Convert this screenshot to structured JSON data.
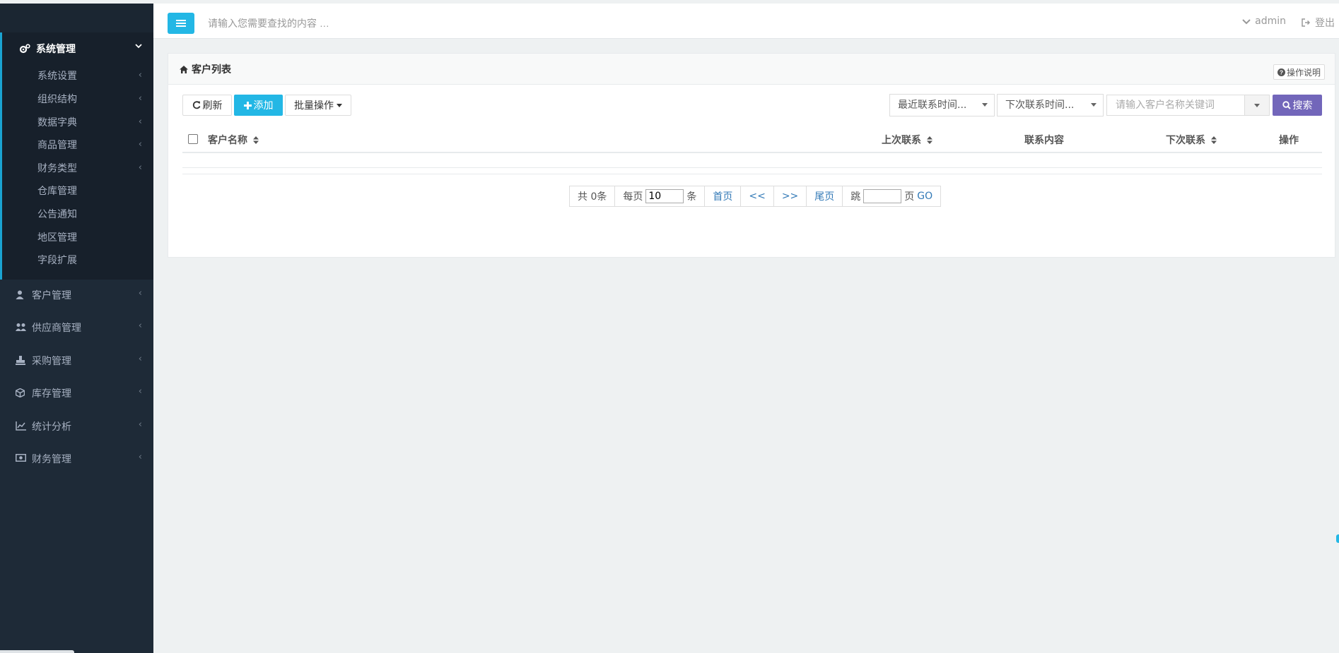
{
  "sidebar": {
    "open_group": {
      "label": "系统管理",
      "items": [
        {
          "label": "系统设置",
          "arrow": "‹"
        },
        {
          "label": "组织结构",
          "arrow": "‹"
        },
        {
          "label": "数据字典",
          "arrow": "‹"
        },
        {
          "label": "商品管理",
          "arrow": "‹"
        },
        {
          "label": "财务类型",
          "arrow": "‹"
        },
        {
          "label": "仓库管理",
          "arrow": ""
        },
        {
          "label": "公告通知",
          "arrow": ""
        },
        {
          "label": "地区管理",
          "arrow": ""
        },
        {
          "label": "字段扩展",
          "arrow": ""
        }
      ]
    },
    "items": [
      {
        "label": "客户管理",
        "icon": "user-icon"
      },
      {
        "label": "供应商管理",
        "icon": "users-icon"
      },
      {
        "label": "采购管理",
        "icon": "stamp-icon"
      },
      {
        "label": "库存管理",
        "icon": "cube-icon"
      },
      {
        "label": "统计分析",
        "icon": "line-chart-icon"
      },
      {
        "label": "财务管理",
        "icon": "money-icon"
      }
    ],
    "arrow": "‹"
  },
  "topbar": {
    "search_placeholder": "请输入您需要查找的内容 …",
    "user": "admin",
    "logout": "登出"
  },
  "panel": {
    "title": "客户列表",
    "help": "操作说明"
  },
  "toolbar": {
    "refresh": "刷新",
    "add": "添加",
    "batch": "批量操作",
    "filter_last": "最近联系时间...",
    "filter_next": "下次联系时间...",
    "keyword_placeholder": "请输入客户名称关键词",
    "search": "搜索"
  },
  "table": {
    "columns": [
      "客户名称",
      "上次联系",
      "联系内容",
      "下次联系",
      "操作"
    ],
    "rows": []
  },
  "pagination": {
    "total": "共 0条",
    "per_page_prefix": "每页",
    "per_page_value": "10",
    "per_page_suffix": "条",
    "first": "首页",
    "prev": "<<",
    "next": ">>",
    "last": "尾页",
    "jump_prefix": "跳",
    "jump_value": "",
    "jump_suffix": "页",
    "go": "GO"
  },
  "colors": {
    "accent": "#23b7e5",
    "search_button": "#7266ba",
    "sidebar": "#1e2a37"
  }
}
